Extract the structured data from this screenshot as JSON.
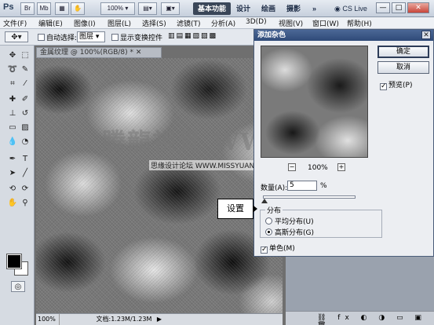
{
  "titlebar": {
    "logo": "Ps",
    "br_label": "Br",
    "mb_label": "Mb",
    "zoom": "100%",
    "workspaces": [
      "基本功能",
      "设计",
      "绘画",
      "摄影"
    ],
    "more": "»",
    "cs_live": "CS Live",
    "window_controls": [
      "—",
      "□",
      "✕"
    ]
  },
  "menu": [
    "文件(F)",
    "编辑(E)",
    "图像(I)",
    "图层(L)",
    "选择(S)",
    "滤镜(T)",
    "分析(A)",
    "3D(D)",
    "视图(V)",
    "窗口(W)",
    "帮助(H)"
  ],
  "options": {
    "auto_select_label": "自动选择:",
    "auto_select_value": "图层",
    "show_transform_label": "显示变换控件"
  },
  "document": {
    "tab_title": "金属纹理 @ 100%(RGB/8) *",
    "zoom_status": "100%",
    "doc_status": "文档:1.23M/1.23M"
  },
  "watermark": {
    "big": "腾龍視覺 WWW.TLVI.NET",
    "small": "思缘设计论坛  WWW.MISSYUAN.COM"
  },
  "annotation": {
    "callout": "设置"
  },
  "dialog": {
    "title": "添加杂色",
    "close": "✕",
    "ok": "确定",
    "cancel": "取消",
    "preview_label": "预览(P)",
    "preview_checked": true,
    "preview_zoom": "100%",
    "zoom_minus": "−",
    "zoom_plus": "+",
    "amount_label": "数量(A):",
    "amount_value": "5",
    "amount_unit": "%",
    "distribution_label": "分布",
    "uniform_label": "平均分布(U)",
    "gaussian_label": "高斯分布(G)",
    "selected_distribution": "gaussian",
    "monochrome_label": "单色(M)",
    "monochrome_checked": true
  }
}
